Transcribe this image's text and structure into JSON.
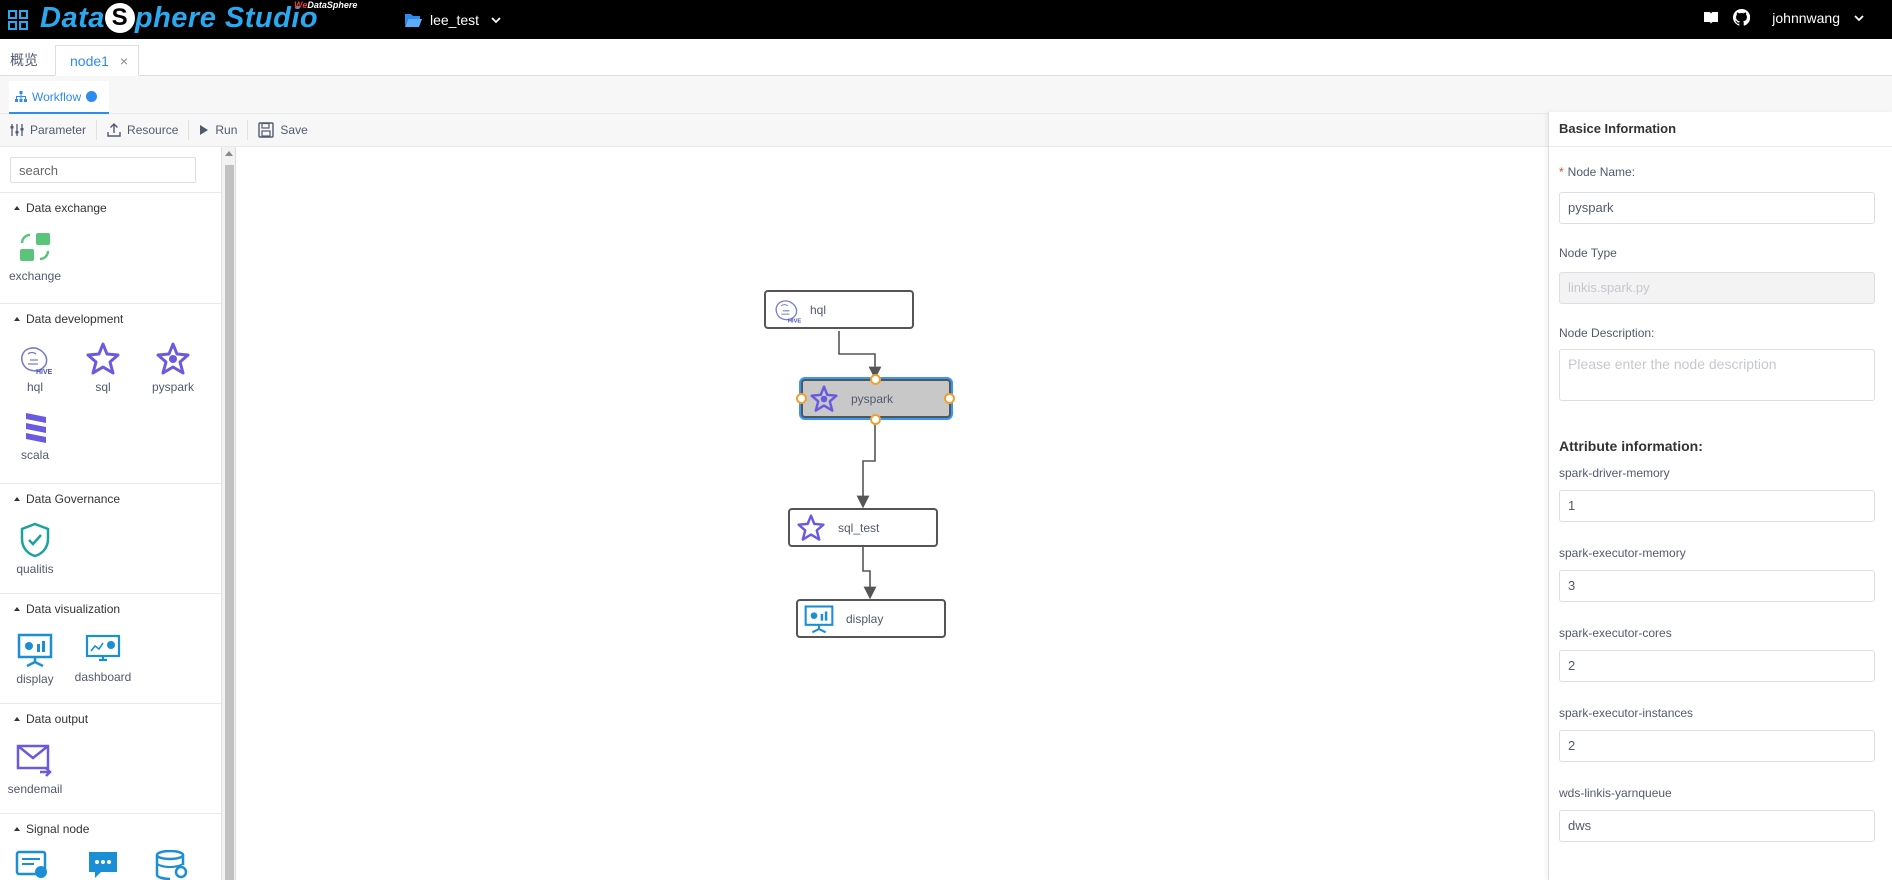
{
  "app": {
    "brand": "DataSphere Studio",
    "brand_prefix": "Data",
    "brand_letter": "S",
    "brand_suffix": "phere Studio",
    "brand_sub_we": "We",
    "brand_sub": "DataSphere",
    "project": "lee_test",
    "user": "johnnwang"
  },
  "tabs": [
    {
      "label": "概览"
    },
    {
      "label": "node1",
      "active": true
    }
  ],
  "workflow_tab": {
    "label": "Workflow"
  },
  "toolbar": {
    "parameter": "Parameter",
    "resource": "Resource",
    "run": "Run",
    "save": "Save"
  },
  "sidebar": {
    "search_placeholder": "search",
    "sections": [
      {
        "title": "Data exchange",
        "items": [
          "exchange"
        ]
      },
      {
        "title": "Data development",
        "items": [
          "hql",
          "sql",
          "pyspark",
          "scala"
        ]
      },
      {
        "title": "Data Governance",
        "items": [
          "qualitis"
        ]
      },
      {
        "title": "Data visualization",
        "items": [
          "display",
          "dashboard"
        ]
      },
      {
        "title": "Data output",
        "items": [
          "sendemail"
        ]
      },
      {
        "title": "Signal node",
        "items": []
      }
    ]
  },
  "workflow": {
    "nodes": [
      {
        "label": "hql"
      },
      {
        "label": "pyspark",
        "selected": true
      },
      {
        "label": "sql_test"
      },
      {
        "label": "display"
      }
    ]
  },
  "panel": {
    "title": "Basice Information",
    "node_name_label": "Node Name:",
    "node_name": "pyspark",
    "node_type_label": "Node Type",
    "node_type": "linkis.spark.py",
    "node_desc_label": "Node Description:",
    "node_desc_placeholder": "Please enter the node description",
    "attr_title": "Attribute information:",
    "attrs": [
      {
        "label": "spark-driver-memory",
        "value": "1"
      },
      {
        "label": "spark-executor-memory",
        "value": "3"
      },
      {
        "label": "spark-executor-cores",
        "value": "2"
      },
      {
        "label": "spark-executor-instances",
        "value": "2"
      },
      {
        "label": "wds-linkis-yarnqueue",
        "value": "dws"
      }
    ]
  },
  "colors": {
    "accent": "#2d8cf0",
    "brand": "#29a9f0",
    "topbar": "#000000",
    "anchor": "#f0a030",
    "spark": "#6a5ae0",
    "exchange": "#5cc47a",
    "qualitis": "#1aa39a"
  }
}
